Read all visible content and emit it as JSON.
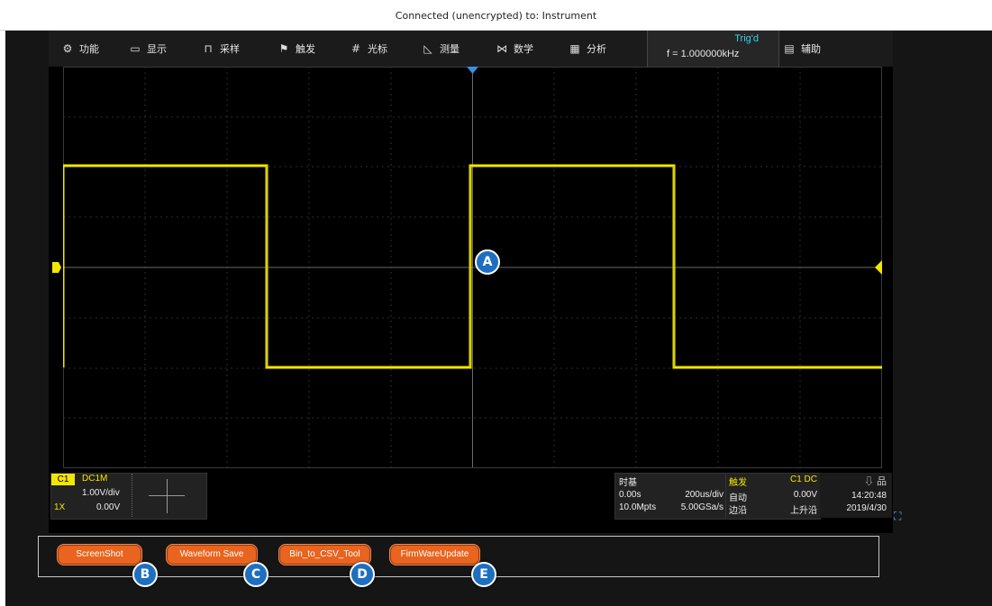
{
  "window": {
    "title": "Connected (unencrypted) to: Instrument"
  },
  "menu": {
    "items": [
      {
        "icon": "gear-icon",
        "glyph": "⚙",
        "label": "功能"
      },
      {
        "icon": "display-icon",
        "glyph": "▭",
        "label": "显示"
      },
      {
        "icon": "acquire-icon",
        "glyph": "⊓",
        "label": "采样"
      },
      {
        "icon": "trigger-flag-icon",
        "glyph": "⚑",
        "label": "触发"
      },
      {
        "icon": "cursor-icon",
        "glyph": "#",
        "label": "光标"
      },
      {
        "icon": "measure-icon",
        "glyph": "◺",
        "label": "测量"
      },
      {
        "icon": "math-icon",
        "glyph": "⋈",
        "label": "数学"
      },
      {
        "icon": "analysis-icon",
        "glyph": "▦",
        "label": "分析"
      }
    ],
    "trigger_status": "Trig'd",
    "frequency": "f = 1.000000kHz",
    "utility": {
      "icon": "utility-icon",
      "glyph": "▤",
      "label": "辅助"
    }
  },
  "channel": {
    "name": "C1",
    "coupling": "DC1M",
    "scale": "1.00V/div",
    "probe": "1X",
    "offset": "0.00V"
  },
  "timebase": {
    "title": "时基",
    "delay": "0.00s",
    "scale": "200us/div",
    "depth": "10.0Mpts",
    "rate": "5.00GSa/s"
  },
  "trigger": {
    "title": "触发",
    "source": "C1 DC",
    "mode": "自动",
    "level": "0.00V",
    "type": "边沿",
    "slope": "上升沿"
  },
  "status": {
    "time": "14:20:48",
    "date": "2019/4/30",
    "icons": "⇩ 品"
  },
  "buttons": [
    {
      "label": "ScreenShot",
      "badge": "B"
    },
    {
      "label": "Waveform Save",
      "badge": "C"
    },
    {
      "label": "Bin_to_CSV_Tool",
      "badge": "D"
    },
    {
      "label": "FirmWareUpdate",
      "badge": "E"
    }
  ],
  "center_badge": "A",
  "colors": {
    "trace": "#f2e600",
    "button": "#e8641f",
    "badge": "#1e6fc0",
    "trig_status": "#3ad0ef"
  }
}
